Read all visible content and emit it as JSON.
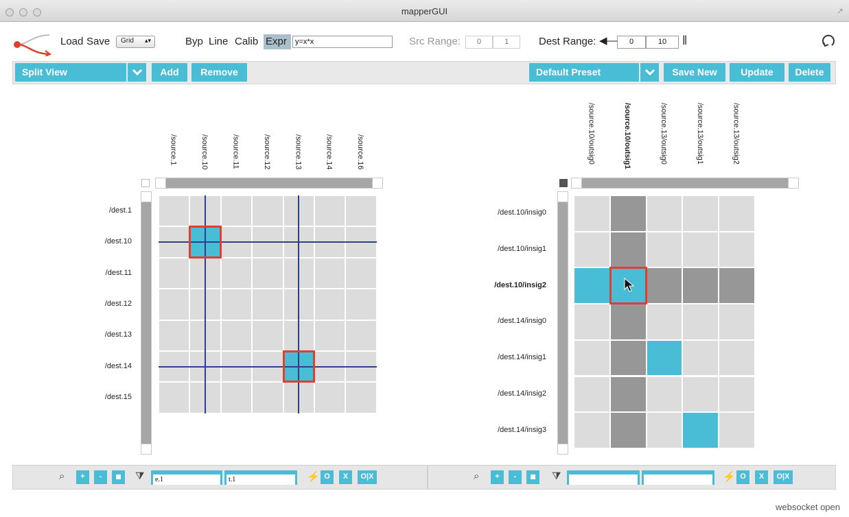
{
  "window": {
    "title": "mapperGUI"
  },
  "toolbar": {
    "load": "Load",
    "save": "Save",
    "view_select": "Grid",
    "modes": [
      "Byp",
      "Line",
      "Calib",
      "Expr"
    ],
    "expression": "y=x*x",
    "src_range_label": "Src Range:",
    "src_min": "0",
    "src_max": "1",
    "dest_range_label": "Dest Range:",
    "dest_min": "0",
    "dest_max": "10"
  },
  "header": {
    "view": "Split View",
    "add": "Add",
    "remove": "Remove",
    "preset": "Default Preset",
    "save_new": "Save New",
    "update": "Update",
    "delete": "Delete"
  },
  "left_grid": {
    "columns": [
      "/source.1",
      "/source.10",
      "/source.11",
      "/source.12",
      "/source.13",
      "/source.14",
      "/source.16"
    ],
    "rows": [
      "/dest.1",
      "/dest.10",
      "/dest.11",
      "/dest.12",
      "/dest.13",
      "/dest.14",
      "/dest.15"
    ],
    "connections": [
      [
        1,
        1
      ],
      [
        5,
        4
      ]
    ]
  },
  "right_grid": {
    "columns": [
      "/source.10/outsig0",
      "/source.10/outsig1",
      "/source.13/outsig0",
      "/source.13/outsig1",
      "/source.13/outsig2"
    ],
    "rows": [
      "/dest.10/insig0",
      "/dest.10/insig1",
      "/dest.10/insig2",
      "/dest.14/insig0",
      "/dest.14/insig1",
      "/dest.14/insig2",
      "/dest.14/insig3"
    ],
    "selected_col": 1,
    "selected_row": 2,
    "connections": [
      [
        2,
        0
      ],
      [
        2,
        1
      ],
      [
        4,
        2
      ],
      [
        6,
        3
      ]
    ]
  },
  "filters": {
    "left_src": "e.1",
    "left_dst": "t.1",
    "right_src": "",
    "right_dst": "",
    "zoom_in": "+",
    "zoom_out": "-",
    "connect": "O",
    "disconnect": "X",
    "toggle": "O|X"
  },
  "status": "websocket open",
  "colors": {
    "accent": "#49bcd6",
    "highlight": "#e0402b",
    "crosshair": "#2d3e8c"
  }
}
